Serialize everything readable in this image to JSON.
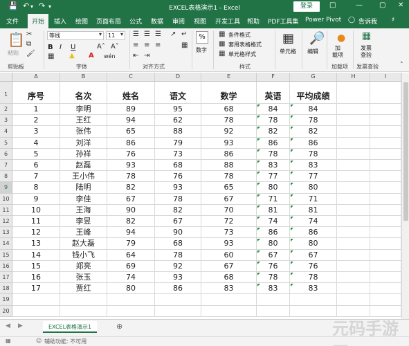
{
  "title_bar": {
    "title": "EXCEL表格演示1 - Excel",
    "login_label": "登录",
    "save_icon": "save-icon",
    "undo_icon": "undo-icon",
    "redo_icon": "redo-icon"
  },
  "tabs": [
    "文件",
    "开始",
    "插入",
    "绘图",
    "页面布局",
    "公式",
    "数据",
    "审阅",
    "视图",
    "开发工具",
    "帮助",
    "PDF工具集",
    "Power Pivot"
  ],
  "active_tab": "开始",
  "tell_me": "告诉我",
  "ribbon": {
    "clipboard": {
      "paste": "粘贴",
      "label": "剪贴板"
    },
    "font": {
      "name": "等线",
      "size": "11",
      "label": "字体",
      "bold": "B",
      "italic": "I",
      "underline": "U",
      "wen": "wén"
    },
    "alignment": {
      "label": "对齐方式"
    },
    "number": {
      "percent": "%",
      "label": "数字"
    },
    "styles": {
      "conditional": "条件格式",
      "table": "套用表格格式",
      "cell_styles": "单元格样式",
      "label": "样式"
    },
    "cells": {
      "label": "单元格"
    },
    "editing": {
      "label": "编辑"
    },
    "addins": {
      "button": "加\n载项",
      "label": "加载项"
    },
    "invoice": {
      "button": "发票\n查验",
      "label": "发票查验"
    }
  },
  "grid": {
    "columns": [
      "A",
      "B",
      "C",
      "D",
      "E",
      "F",
      "G",
      "H",
      "I"
    ],
    "row_numbers": [
      "1",
      "2",
      "3",
      "4",
      "5",
      "6",
      "7",
      "8",
      "9",
      "10",
      "11",
      "12",
      "13",
      "14",
      "15",
      "16",
      "17",
      "18",
      "19",
      "20"
    ],
    "headers": [
      "序号",
      "名次",
      "姓名",
      "语文",
      "数学",
      "英语",
      "平均成绩"
    ],
    "rows": [
      [
        "1",
        "李明",
        "89",
        "95",
        "68",
        "84",
        "84"
      ],
      [
        "2",
        "王红",
        "94",
        "62",
        "78",
        "78",
        "78"
      ],
      [
        "3",
        "张伟",
        "65",
        "88",
        "92",
        "82",
        "82"
      ],
      [
        "4",
        "刘洋",
        "86",
        "79",
        "93",
        "86",
        "86"
      ],
      [
        "5",
        "孙祥",
        "76",
        "73",
        "86",
        "78",
        "78"
      ],
      [
        "6",
        "赵磊",
        "93",
        "68",
        "88",
        "83",
        "83"
      ],
      [
        "7",
        "王小伟",
        "78",
        "76",
        "78",
        "77",
        "77"
      ],
      [
        "8",
        "陆明",
        "82",
        "93",
        "65",
        "80",
        "80"
      ],
      [
        "9",
        "李佳",
        "67",
        "78",
        "67",
        "71",
        "71"
      ],
      [
        "10",
        "王海",
        "90",
        "82",
        "70",
        "81",
        "81"
      ],
      [
        "11",
        "李昱",
        "82",
        "67",
        "72",
        "74",
        "74"
      ],
      [
        "12",
        "王峰",
        "94",
        "90",
        "73",
        "86",
        "86"
      ],
      [
        "13",
        "赵大磊",
        "79",
        "68",
        "93",
        "80",
        "80"
      ],
      [
        "14",
        "钱小飞",
        "64",
        "78",
        "60",
        "67",
        "67"
      ],
      [
        "15",
        "郑亮",
        "69",
        "92",
        "67",
        "76",
        "76"
      ],
      [
        "16",
        "张玉",
        "74",
        "93",
        "68",
        "78",
        "78"
      ],
      [
        "17",
        "贾红",
        "80",
        "86",
        "83",
        "83",
        "83"
      ]
    ]
  },
  "sheet_tab": "EXCEL表格演示1",
  "status": "辅助功能: 不可用",
  "watermark": "元码手游网",
  "accent_color": "#217346"
}
